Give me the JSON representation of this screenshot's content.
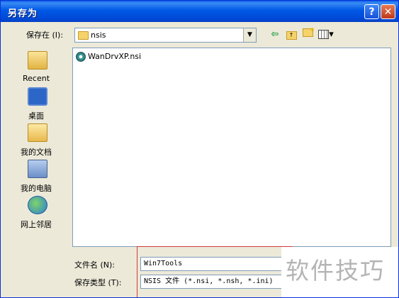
{
  "window": {
    "title": "另存为",
    "help_label": "?",
    "close_label": "✕"
  },
  "toolbar": {
    "save_in_label": "保存在 (I):",
    "save_in_value": "nsis",
    "combo_arrow": "▼",
    "back_icon": "⇦",
    "up_icon": "up-folder-icon",
    "new_folder_icon": "new-folder-icon",
    "views_icon": "views-menu-icon",
    "views_arrow": "▾"
  },
  "places": [
    {
      "label": "Recent",
      "icon": "recent-folder-icon"
    },
    {
      "label": "桌面",
      "icon": "desktop-icon"
    },
    {
      "label": "我的文档",
      "icon": "my-documents-icon"
    },
    {
      "label": "我的电脑",
      "icon": "my-computer-icon"
    },
    {
      "label": "网上邻居",
      "icon": "network-places-icon"
    }
  ],
  "files": [
    {
      "name": "WanDrvXP.nsi",
      "icon": "nsi-file-icon"
    }
  ],
  "form": {
    "filename_label": "文件名 (N):",
    "filename_value": "Win7Tools",
    "filetype_label": "保存类型 (T):",
    "filetype_value": "NSIS 文件 (*.nsi, *.nsh, *.ini)"
  },
  "watermark": "软件技巧",
  "colors": {
    "titlebar": "#0058e6",
    "dialog_bg": "#ece9d8",
    "highlight_box": "#d43a3a"
  }
}
